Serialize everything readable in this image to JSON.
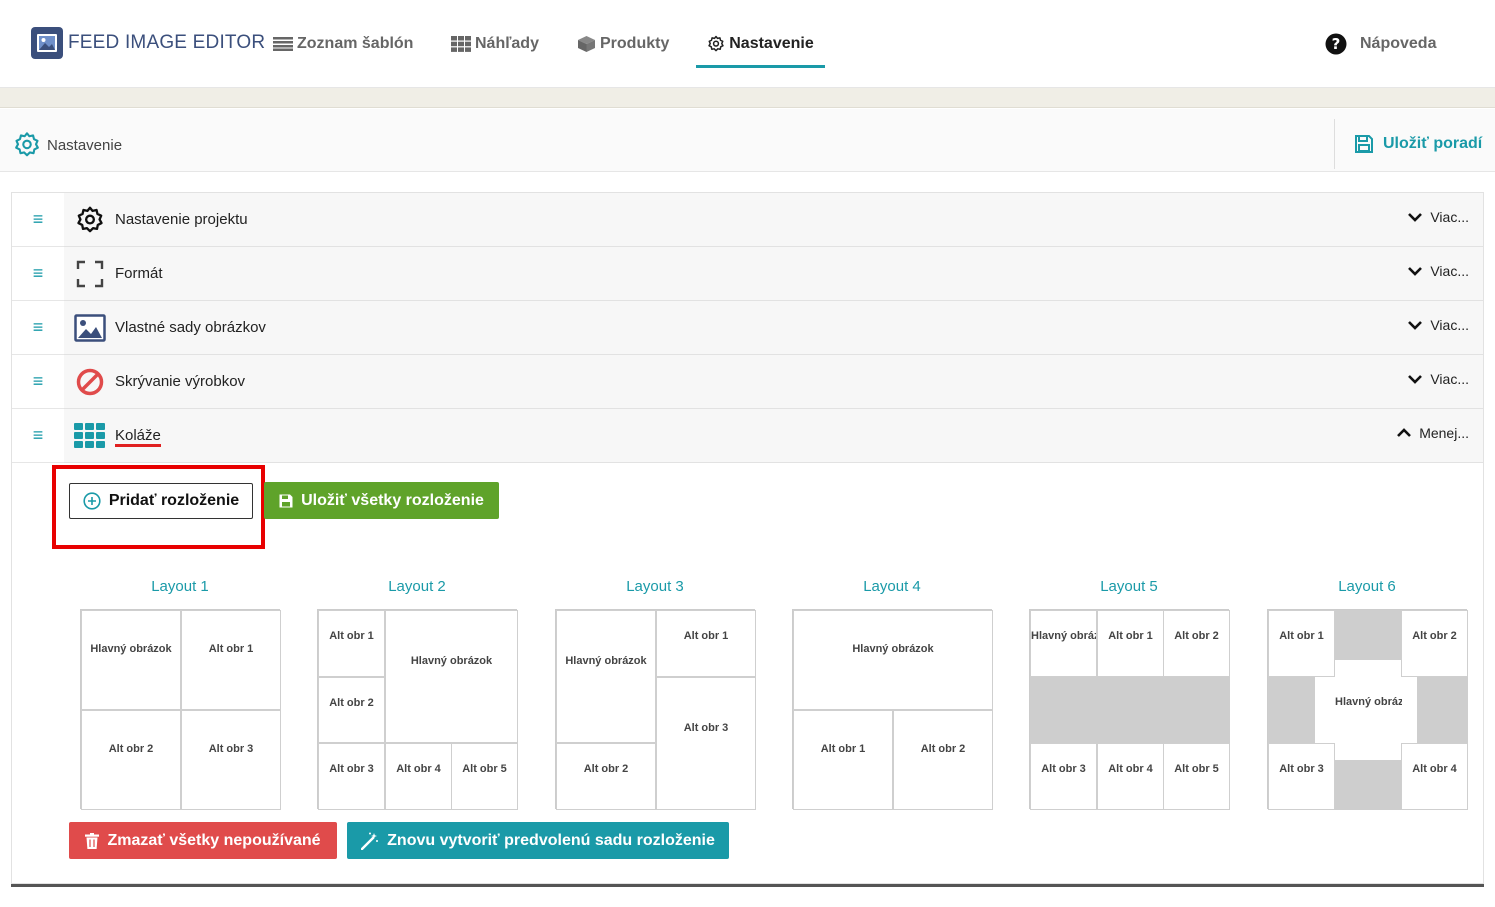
{
  "app": {
    "title": "FEED IMAGE EDITOR"
  },
  "nav": {
    "templates": "Zoznam šablón",
    "previews": "Náhľady",
    "products": "Produkty",
    "settings": "Nastavenie",
    "help": "Nápoveda",
    "active": "settings"
  },
  "settings_bar": {
    "title": "Nastavenie",
    "save_order": "Uložiť poradí"
  },
  "accordion": [
    {
      "label": "Nastavenie projektu",
      "toggle": "Viac...",
      "icon": "gear-icon",
      "expanded": false
    },
    {
      "label": "Formát",
      "toggle": "Viac...",
      "icon": "crop-frame-icon",
      "expanded": false
    },
    {
      "label": "Vlastné sady obrázkov",
      "toggle": "Viac...",
      "icon": "image-icon",
      "expanded": false
    },
    {
      "label": "Skrývanie výrobkov",
      "toggle": "Viac...",
      "icon": "ban-icon",
      "expanded": false
    },
    {
      "label": "Koláže",
      "toggle": "Menej...",
      "icon": "grid-icon",
      "expanded": true
    }
  ],
  "collage": {
    "add_layout": "Pridať rozloženie",
    "save_all": "Uložiť všetky rozloženie",
    "delete_unused": "Zmazať všetky nepoužívané",
    "recreate_default": "Znovu vytvoriť predvolenú sadu rozloženie"
  },
  "layouts": [
    {
      "title": "Layout 1",
      "cells": [
        "Hlavný obrázok",
        "Alt obr 1",
        "Alt obr 2",
        "Alt obr 3"
      ]
    },
    {
      "title": "Layout 2",
      "cells": [
        "Alt obr 1",
        "Hlavný obrázok",
        "Alt obr 2",
        "Alt obr 3",
        "Alt obr 4",
        "Alt obr 5"
      ]
    },
    {
      "title": "Layout 3",
      "cells": [
        "Hlavný obrázok",
        "Alt obr 1",
        "Alt obr 3",
        "Alt obr 2"
      ]
    },
    {
      "title": "Layout 4",
      "cells": [
        "Hlavný obrázok",
        "Alt obr 1",
        "Alt obr 2"
      ]
    },
    {
      "title": "Layout 5",
      "cells": [
        "Hlavný obrázok",
        "Alt obr 1",
        "Alt obr 2",
        "Alt obr 3",
        "Alt obr 4",
        "Alt obr 5"
      ]
    },
    {
      "title": "Layout 6",
      "cells": [
        "Alt obr 1",
        "Alt obr 2",
        "Hlavný obrázok",
        "Alt obr 3",
        "Alt obr 4"
      ]
    }
  ],
  "colors": {
    "accent": "#1a9aa8",
    "brand": "#3b4f7c",
    "green": "#5fa32a",
    "red": "#e04b4b",
    "highlight": "#e80000"
  }
}
